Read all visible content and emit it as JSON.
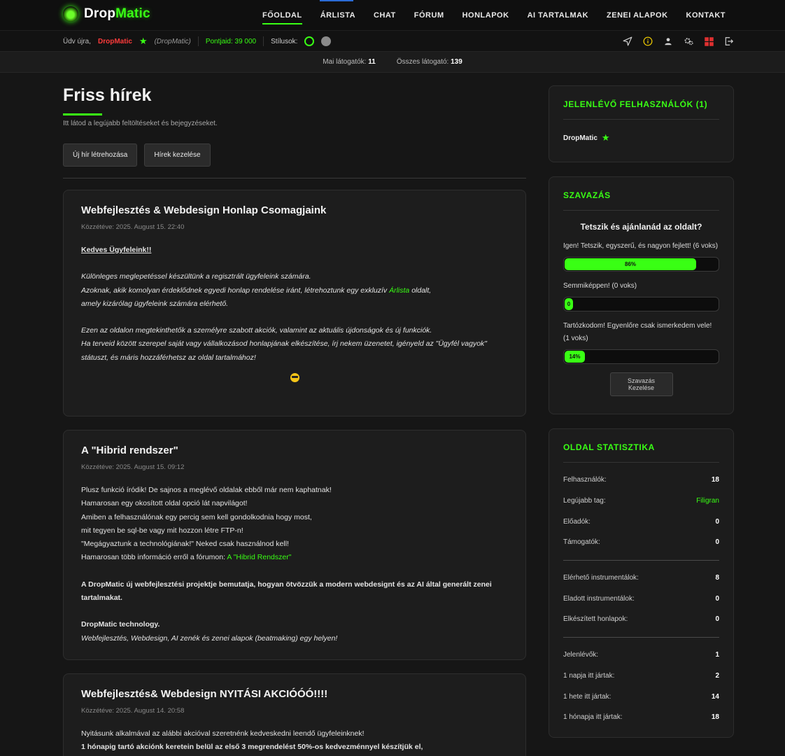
{
  "brand": {
    "name_part1": "Drop",
    "name_part2": "Matic"
  },
  "nav": [
    "FŐOLDAL",
    "ÁRLISTA",
    "CHAT",
    "FÓRUM",
    "HONLAPOK",
    "AI TARTALMAK",
    "ZENEI ALAPOK",
    "KONTAKT"
  ],
  "subbar": {
    "welcome": "Üdv újra,",
    "username": "DropMatic",
    "username_paren": "(DropMatic)",
    "points": "Pontjaid: 39 000",
    "styles_label": "Stílusok:"
  },
  "icons_right": [
    "send-icon",
    "info-icon",
    "user-icon",
    "settings-icon",
    "dashboard-icon",
    "logout-icon"
  ],
  "visitors": {
    "today_label": "Mai látogatók:",
    "today_value": "11",
    "total_label": "Összes látogató:",
    "total_value": "139"
  },
  "main": {
    "title": "Friss hírek",
    "subtitle": "Itt látod a legújabb feltöltéseket és bejegyzéseket.",
    "btn_new": "Új hír létrehozása",
    "btn_manage": "Hírek kezelése"
  },
  "posts": [
    {
      "title": "Webfejlesztés & Webdesign Honlap Csomagjaink",
      "date": "Közzétéve: 2025. August 15. 22:40",
      "greeting": "Kedves Ügyfeleink!!",
      "l1": "Különleges meglepetéssel készültünk a regisztrált ügyfeleink számára.",
      "l2a": "Azoknak, akik komolyan érdeklődnek egyedi honlap rendelése iránt, létrehoztunk egy exkluzív ",
      "l2link": "Árlista",
      "l2b": " oldalt,",
      "l3": "amely kizárólag ügyfeleink számára elérhető.",
      "l4": "Ezen az oldalon megtekinthetők a személyre szabott akciók, valamint az aktuális újdonságok és új funkciók.",
      "l5": "Ha terveid között szerepel saját vagy vállalkozásod honlapjának elkészítése, írj nekem üzenetet, igényeld az \"Ügyfél vagyok\"",
      "l6": "státuszt, és máris hozzáférhetsz az oldal tartalmához!"
    },
    {
      "title": "A \"Hibrid rendszer\"",
      "date": "Közzétéve: 2025. August 15. 09:12",
      "l1": "Plusz funkció íródik! De sajnos a meglévő oldalak ebből már nem kaphatnak!",
      "l2": "Hamarosan egy okosított oldal opció lát napvilágot!",
      "l3": "Amiben a felhasználónak egy percig sem kell gondolkodnia hogy most,",
      "l4": "mit tegyen be sql-be vagy mit hozzon létre FTP-n!",
      "l5": "\"Megágyaztunk a technológiának!\" Neked csak használnod kell!",
      "l6a": "Hamarosan több információ erről a fórumon: ",
      "l6link": "A \"Hibrid Rendszer\"",
      "b1": "A DropMatic új webfejlesztési projektje bemutatja, hogyan ötvözzük a modern webdesignt és az AI által generált zenei",
      "b2": "tartalmakat.",
      "b3": "DropMatic technology.",
      "i1": "Webfejlesztés, Webdesign, AI zenék és zenei alapok (beatmaking) egy helyen!"
    },
    {
      "title": "Webfejlesztés& Webdesign NYITÁSI AKCIÓÓÓ!!!!",
      "date": "Közzétéve: 2025. August 14. 20:58",
      "l1": "Nyitásunk alkalmával az alábbi akcióval szeretnénk kedveskedni leendő ügyfeleinknek!",
      "l2": "1 hónapig tartó akciónk keretein belül az első 3 megrendelést 50%-os kedvezménnyel készítjük el,"
    }
  ],
  "online": {
    "title": "JELENLÉVŐ FELHASZNÁLÓK (1)",
    "user": "DropMatic"
  },
  "poll": {
    "title": "SZAVAZÁS",
    "question": "Tetszik és ajánlanád az oldalt?",
    "options": [
      {
        "label": "Igen! Tetszik, egyszerű, és nagyon fejlett! (6 voks)",
        "percent": 86,
        "text": "86%"
      },
      {
        "label": "Semmiképpen! (0 voks)",
        "percent": 0,
        "text": "0"
      },
      {
        "label": "Tartózkodom! Egyenlőre csak ismerkedem vele! (1 voks)",
        "percent": 14,
        "text": "14%"
      }
    ],
    "manage": "Szavazás Kezelése"
  },
  "stats": {
    "title": "OLDAL STATISZTIKA",
    "group1": [
      {
        "label": "Felhasználók:",
        "value": "18"
      },
      {
        "label": "Legújabb tag:",
        "value": "Filigran"
      },
      {
        "label": "Előadók:",
        "value": "0"
      },
      {
        "label": "Támogatók:",
        "value": "0"
      }
    ],
    "group2": [
      {
        "label": "Elérhető instrumentálok:",
        "value": "8"
      },
      {
        "label": "Eladott instrumentálok:",
        "value": "0"
      },
      {
        "label": "Elkészített honlapok:",
        "value": "0"
      }
    ],
    "group3": [
      {
        "label": "Jelenlévők:",
        "value": "1"
      },
      {
        "label": "1 napja itt jártak:",
        "value": "2"
      },
      {
        "label": "1 hete itt jártak:",
        "value": "14"
      },
      {
        "label": "1 hónapja itt jártak:",
        "value": "18"
      }
    ]
  },
  "colors": {
    "accent": "#39ff14",
    "username": "#ff3b3b",
    "background": "#161616"
  }
}
